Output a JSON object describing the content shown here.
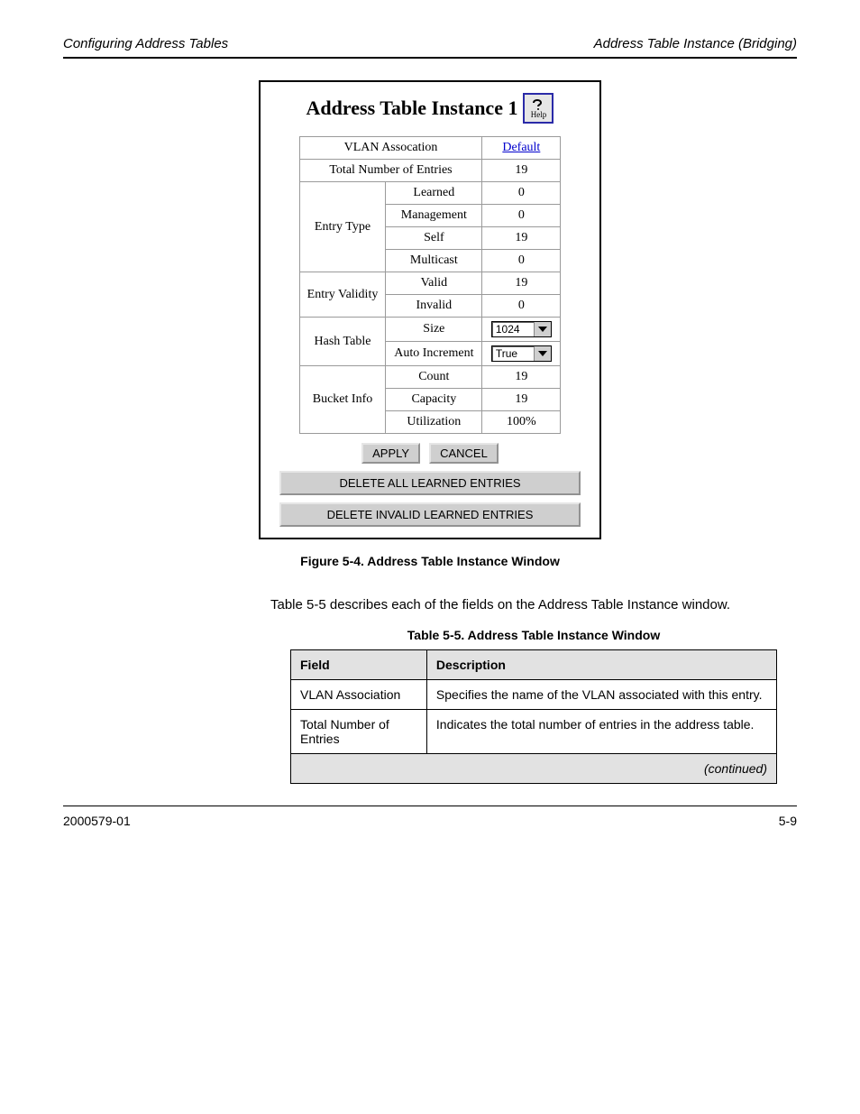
{
  "running": {
    "left": "Configuring Address Tables",
    "right": "Address Table Instance (Bridging)"
  },
  "dialog": {
    "title": "Address Table Instance 1",
    "help_label": "Help",
    "rows": {
      "vlan": {
        "label": "VLAN Assocation",
        "value": "Default"
      },
      "total": {
        "label": "Total Number of Entries",
        "value": "19"
      },
      "entry_type": {
        "group": "Entry Type",
        "learned": {
          "label": "Learned",
          "value": "0"
        },
        "management": {
          "label": "Management",
          "value": "0"
        },
        "self": {
          "label": "Self",
          "value": "19"
        },
        "multicast": {
          "label": "Multicast",
          "value": "0"
        }
      },
      "entry_validity": {
        "group": "Entry Validity",
        "valid": {
          "label": "Valid",
          "value": "19"
        },
        "invalid": {
          "label": "Invalid",
          "value": "0"
        }
      },
      "hash": {
        "group": "Hash Table",
        "size": {
          "label": "Size",
          "value": "1024"
        },
        "auto": {
          "label": "Auto Increment",
          "value": "True"
        }
      },
      "bucket": {
        "group": "Bucket Info",
        "count": {
          "label": "Count",
          "value": "19"
        },
        "capacity": {
          "label": "Capacity",
          "value": "19"
        },
        "utilization": {
          "label": "Utilization",
          "value": "100%"
        }
      }
    },
    "buttons": {
      "apply": "APPLY",
      "cancel": "CANCEL",
      "del_all": "DELETE ALL LEARNED ENTRIES",
      "del_invalid": "DELETE INVALID LEARNED ENTRIES"
    }
  },
  "caption": "Figure 5-4. Address Table Instance Window",
  "description": "Table 5-5 describes each of the fields on the Address Table Instance window.",
  "ref_table": {
    "title": "Table 5-5. Address Table Instance Window",
    "head": {
      "field": "Field",
      "desc": "Description"
    },
    "rows": [
      {
        "field": "VLAN Association",
        "desc": "Specifies the name of the VLAN associated with this entry."
      },
      {
        "field": "Total Number of Entries",
        "desc": "Indicates the total number of entries in the address table."
      }
    ],
    "continued": "(continued)"
  },
  "footer": {
    "left": "2000579-01",
    "right": "5-9"
  }
}
